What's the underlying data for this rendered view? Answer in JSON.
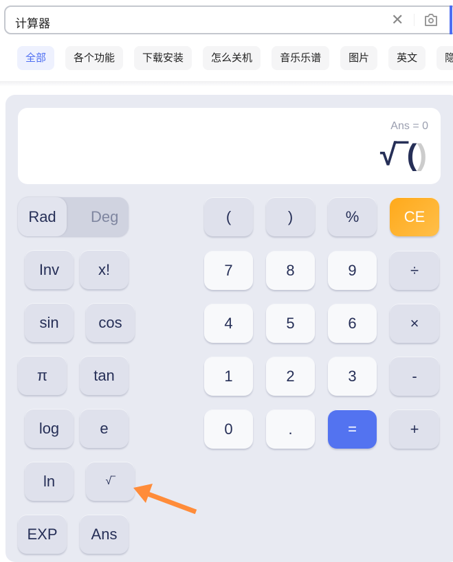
{
  "search": {
    "query": "计算器",
    "clear_icon": "close-icon",
    "camera_icon": "camera-icon"
  },
  "tabs": [
    {
      "label": "全部",
      "active": true
    },
    {
      "label": "各个功能"
    },
    {
      "label": "下载安装"
    },
    {
      "label": "怎么关机"
    },
    {
      "label": "音乐乐谱"
    },
    {
      "label": "图片"
    },
    {
      "label": "英文"
    },
    {
      "label": "隐"
    }
  ],
  "display": {
    "ans": "Ans = 0",
    "expr_open": "√‾(",
    "expr_close": ")"
  },
  "mode": {
    "on": "Rad",
    "off": "Deg"
  },
  "sci": [
    "Inv",
    "x!",
    "sin",
    "cos",
    "π",
    "tan",
    "log",
    "e",
    "ln",
    "√‾",
    "EXP",
    "Ans"
  ],
  "keys": [
    "(",
    ")",
    "%",
    "CE",
    "7",
    "8",
    "9",
    "÷",
    "4",
    "5",
    "6",
    "×",
    "1",
    "2",
    "3",
    "-",
    "0",
    ".",
    "=",
    "+"
  ],
  "colors": {
    "accent": "#4e6ef2",
    "ce": "#ffaa1f",
    "equals": "#5373f0",
    "annotation_arrow": "#ff8c3a"
  }
}
